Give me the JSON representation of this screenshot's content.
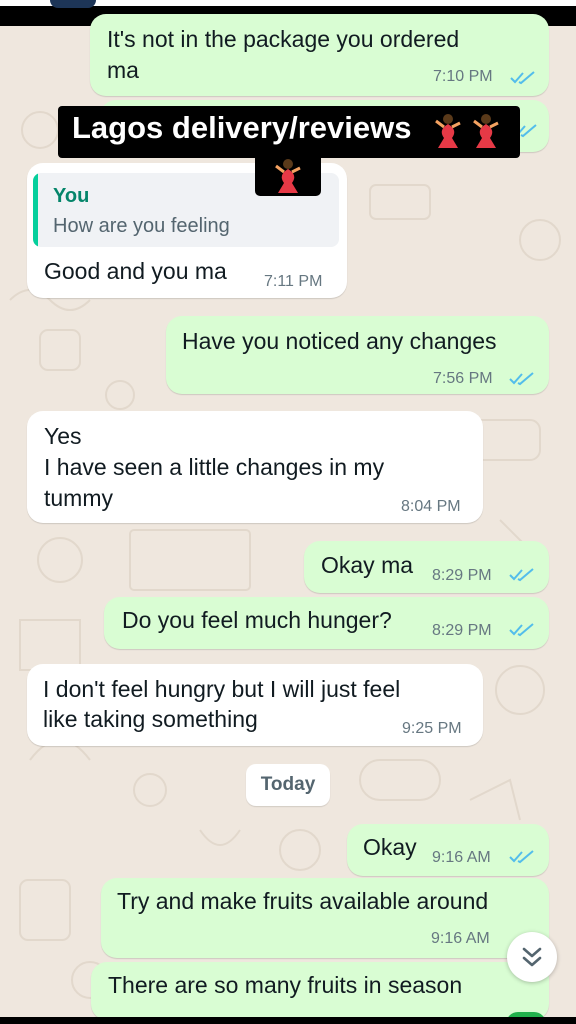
{
  "overlay": {
    "title": "Lagos delivery/reviews"
  },
  "messages": [
    {
      "text_lines": [
        "It's not in the package you ordered",
        "ma"
      ],
      "time": "7:10 PM"
    },
    {
      "quoted_author": "You",
      "quoted_text": "How are you feeling",
      "text_lines": [
        "Good and you ma"
      ],
      "time": "7:11 PM"
    },
    {
      "text_lines": [
        "Have you noticed any changes"
      ],
      "time": "7:56 PM"
    },
    {
      "text_lines": [
        "Yes",
        "I have seen a little changes in my",
        "tummy"
      ],
      "time": "8:04 PM"
    },
    {
      "text_lines": [
        "Okay ma"
      ],
      "time": "8:29 PM"
    },
    {
      "text_lines": [
        "Do you feel much hunger?"
      ],
      "time": "8:29 PM"
    },
    {
      "text_lines": [
        "I don't feel hungry but I will just feel",
        "like taking something"
      ],
      "time": "9:25 PM"
    },
    {
      "text_lines": [
        "Okay"
      ],
      "time": "9:16 AM"
    },
    {
      "text_lines": [
        "Try and make fruits available around"
      ],
      "time": "9:16 AM"
    },
    {
      "text_lines": [
        "There are so many fruits in season"
      ]
    }
  ],
  "date_chip": "Today",
  "icons": {
    "read_receipt": "double-check-icon",
    "scroll_down": "double-chevron-down-icon",
    "emoji": "dancing-woman-emoji"
  },
  "colors": {
    "outgoing_bubble": "#d9fdd3",
    "incoming_bubble": "#ffffff",
    "read_tick": "#53bdeb",
    "wallpaper": "#efe7de",
    "quote_accent": "#06cf9c"
  }
}
